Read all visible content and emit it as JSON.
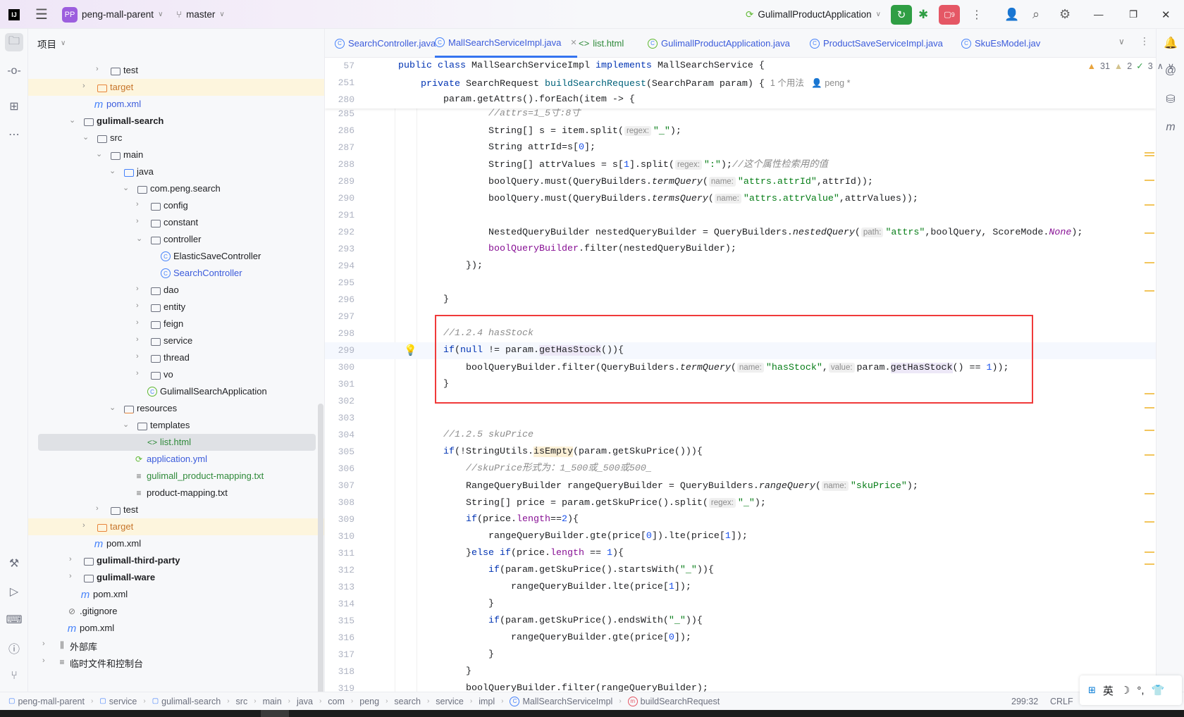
{
  "titlebar": {
    "logo": "IJ",
    "project_badge": "PP",
    "project_name": "peng-mall-parent",
    "branch": "master",
    "run_config": "GulimallProductApplication",
    "stop_count": "9",
    "icons": [
      "menu-icon",
      "branch-icon",
      "rerun-icon",
      "debug-icon",
      "stop-icon",
      "more-icon",
      "add-user-icon",
      "search-icon",
      "settings-icon",
      "minimize-icon",
      "restore-icon",
      "close-icon"
    ]
  },
  "project_panel": {
    "title": "项目",
    "rows": [
      {
        "n": 4,
        "chev": "right",
        "icon": "folder",
        "label": "test"
      },
      {
        "n": 3,
        "chev": "right",
        "icon": "folder-orange",
        "label": "target",
        "style": "orange",
        "hl": true
      },
      {
        "n": 3,
        "chev": "",
        "icon": "maven",
        "label": "pom.xml",
        "style": "blue"
      },
      {
        "n": 2,
        "chev": "down",
        "icon": "module",
        "label": "gulimall-search",
        "style": "bold"
      },
      {
        "n": 3,
        "chev": "down",
        "icon": "folder",
        "label": "src"
      },
      {
        "n": 4,
        "chev": "down",
        "icon": "folder",
        "label": "main"
      },
      {
        "n": 5,
        "chev": "down",
        "icon": "folder-blue",
        "label": "java"
      },
      {
        "n": 6,
        "chev": "down",
        "icon": "package",
        "label": "com.peng.search"
      },
      {
        "n": 7,
        "chev": "right",
        "icon": "package",
        "label": "config"
      },
      {
        "n": 7,
        "chev": "right",
        "icon": "package",
        "label": "constant"
      },
      {
        "n": 7,
        "chev": "down",
        "icon": "package",
        "label": "controller"
      },
      {
        "n": 8,
        "chev": "",
        "icon": "class",
        "label": "ElasticSaveController"
      },
      {
        "n": 8,
        "chev": "",
        "icon": "class",
        "label": "SearchController",
        "style": "blue"
      },
      {
        "n": 7,
        "chev": "right",
        "icon": "package",
        "label": "dao"
      },
      {
        "n": 7,
        "chev": "right",
        "icon": "package",
        "label": "entity"
      },
      {
        "n": 7,
        "chev": "right",
        "icon": "package",
        "label": "feign"
      },
      {
        "n": 7,
        "chev": "right",
        "icon": "package",
        "label": "service"
      },
      {
        "n": 7,
        "chev": "right",
        "icon": "package",
        "label": "thread"
      },
      {
        "n": 7,
        "chev": "right",
        "icon": "package",
        "label": "vo"
      },
      {
        "n": 7,
        "chev": "",
        "icon": "spring-class",
        "label": "GulimallSearchApplication"
      },
      {
        "n": 5,
        "chev": "down",
        "icon": "resources",
        "label": "resources"
      },
      {
        "n": 6,
        "chev": "down",
        "icon": "folder",
        "label": "templates"
      },
      {
        "n": 7,
        "chev": "",
        "icon": "html",
        "label": "list.html",
        "style": "green",
        "sel": true
      },
      {
        "n": 6,
        "chev": "",
        "icon": "spring-yml",
        "label": "application.yml",
        "style": "blue"
      },
      {
        "n": 6,
        "chev": "",
        "icon": "text",
        "label": "gulimall_product-mapping.txt",
        "style": "green"
      },
      {
        "n": 6,
        "chev": "",
        "icon": "text",
        "label": "product-mapping.txt"
      },
      {
        "n": 4,
        "chev": "right",
        "icon": "folder",
        "label": "test"
      },
      {
        "n": 3,
        "chev": "right",
        "icon": "folder-orange",
        "label": "target",
        "style": "orange",
        "hl": true
      },
      {
        "n": 3,
        "chev": "",
        "icon": "maven",
        "label": "pom.xml"
      },
      {
        "n": 2,
        "chev": "right",
        "icon": "module",
        "label": "gulimall-third-party",
        "style": "bold"
      },
      {
        "n": 2,
        "chev": "right",
        "icon": "module",
        "label": "gulimall-ware",
        "style": "bold"
      },
      {
        "n": 2,
        "chev": "",
        "icon": "maven",
        "label": "pom.xml"
      },
      {
        "n": 1,
        "chev": "",
        "icon": "ignore",
        "label": ".gitignore"
      },
      {
        "n": 1,
        "chev": "",
        "icon": "maven",
        "label": "pom.xml"
      },
      {
        "n": 0,
        "chev": "right",
        "icon": "library",
        "label": "外部库"
      },
      {
        "n": 0,
        "chev": "right",
        "icon": "scratch",
        "label": "临时文件和控制台"
      }
    ]
  },
  "tabs": [
    {
      "label": "SearchController.java",
      "icon": "class",
      "color": "#3b5bdb"
    },
    {
      "label": "MallSearchServiceImpl.java",
      "icon": "class",
      "color": "#3b5bdb",
      "active": true
    },
    {
      "label": "list.html",
      "icon": "html",
      "color": "#2f8a3a"
    },
    {
      "label": "GulimallProductApplication.java",
      "icon": "spring-class",
      "color": "#3b5bdb"
    },
    {
      "label": "ProductSaveServiceImpl.java",
      "icon": "class",
      "color": "#3b5bdb"
    },
    {
      "label": "SkuEsModel.jav",
      "icon": "class",
      "color": "#3b5bdb"
    }
  ],
  "inspections": {
    "warnings": "31",
    "weak_warnings": "2",
    "typos": "3"
  },
  "sticky_lines": [
    {
      "n": "57",
      "t": [
        [
          "kw",
          "public class "
        ],
        [
          "p",
          "MallSearchServiceImpl "
        ],
        [
          "kw",
          "implements "
        ],
        [
          "p",
          "MallSearchService {"
        ]
      ]
    },
    {
      "n": "251",
      "t": [
        [
          "kw",
          "    private "
        ],
        [
          "p",
          "SearchRequest "
        ],
        [
          "fd",
          "buildSearchRequest"
        ],
        [
          "p",
          "(SearchParam param) { "
        ],
        [
          "meta",
          "1 个用法"
        ],
        [
          "meta",
          "   👤 peng *"
        ]
      ]
    },
    {
      "n": "280",
      "t": [
        [
          "p",
          "        param.getAttrs().forEach(item -> {"
        ]
      ]
    }
  ],
  "code_lines": [
    {
      "n": "285",
      "t": [
        [
          "cm",
          "                //attrs=1_5寸:8寸"
        ]
      ]
    },
    {
      "n": "286",
      "t": [
        [
          "p",
          "                String[] s = item.split("
        ],
        [
          "hint",
          "regex:"
        ],
        [
          "str",
          "\"_\""
        ],
        [
          "p",
          ");"
        ]
      ]
    },
    {
      "n": "287",
      "t": [
        [
          "p",
          "                String attrId=s["
        ],
        [
          "num",
          "0"
        ],
        [
          "p",
          "];"
        ]
      ]
    },
    {
      "n": "288",
      "t": [
        [
          "p",
          "                String[] attrValues = s["
        ],
        [
          "num",
          "1"
        ],
        [
          "p",
          "].split("
        ],
        [
          "hint",
          "regex:"
        ],
        [
          "str",
          "\":\""
        ],
        [
          "p",
          ");"
        ],
        [
          "cm",
          "//这个属性检索用的值"
        ]
      ]
    },
    {
      "n": "289",
      "t": [
        [
          "p",
          "                boolQuery.must(QueryBuilders."
        ],
        [
          "it",
          "termQuery"
        ],
        [
          "p",
          "("
        ],
        [
          "hint",
          "name:"
        ],
        [
          "str",
          "\"attrs.attrId\""
        ],
        [
          "p",
          ",attrId));"
        ]
      ]
    },
    {
      "n": "290",
      "t": [
        [
          "p",
          "                boolQuery.must(QueryBuilders."
        ],
        [
          "it",
          "termsQuery"
        ],
        [
          "p",
          "("
        ],
        [
          "hint",
          "name:"
        ],
        [
          "str",
          "\"attrs.attrValue\""
        ],
        [
          "p",
          ",attrValues));"
        ]
      ]
    },
    {
      "n": "291",
      "t": []
    },
    {
      "n": "292",
      "t": [
        [
          "p",
          "                NestedQueryBuilder nestedQueryBuilder = QueryBuilders."
        ],
        [
          "it",
          "nestedQuery"
        ],
        [
          "p",
          "("
        ],
        [
          "hint",
          "path:"
        ],
        [
          "str",
          "\"attrs\""
        ],
        [
          "p",
          ",boolQuery, ScoreMode."
        ],
        [
          "itp",
          "None"
        ],
        [
          "p",
          ");"
        ]
      ]
    },
    {
      "n": "293",
      "t": [
        [
          "fld",
          "                boolQueryBuilder"
        ],
        [
          "p",
          ".filter(nestedQueryBuilder);"
        ]
      ]
    },
    {
      "n": "294",
      "t": [
        [
          "p",
          "            });"
        ]
      ]
    },
    {
      "n": "295",
      "t": []
    },
    {
      "n": "296",
      "t": [
        [
          "p",
          "        }"
        ]
      ]
    },
    {
      "n": "297",
      "t": []
    },
    {
      "n": "298",
      "t": [
        [
          "cm",
          "        //1.2.4 hasStock"
        ]
      ]
    },
    {
      "n": "299",
      "cur": true,
      "t": [
        [
          "kw",
          "        if"
        ],
        [
          "p",
          "("
        ],
        [
          "kw",
          "null"
        ],
        [
          "p",
          " != param."
        ],
        [
          "mh",
          "getHasStock"
        ],
        [
          "p",
          "()){"
        ]
      ]
    },
    {
      "n": "300",
      "t": [
        [
          "p",
          "            boolQueryBuilder.filter(QueryBuilders."
        ],
        [
          "it",
          "termQuery"
        ],
        [
          "p",
          "("
        ],
        [
          "hint",
          "name:"
        ],
        [
          "str",
          "\"hasStock\""
        ],
        [
          "p",
          ","
        ],
        [
          "hint",
          "value:"
        ],
        [
          "p",
          "param."
        ],
        [
          "mh",
          "getHasStock"
        ],
        [
          "p",
          "() == "
        ],
        [
          "num",
          "1"
        ],
        [
          "p",
          "));"
        ]
      ]
    },
    {
      "n": "301",
      "t": [
        [
          "p",
          "        }"
        ]
      ]
    },
    {
      "n": "302",
      "t": []
    },
    {
      "n": "303",
      "t": []
    },
    {
      "n": "304",
      "t": [
        [
          "cm",
          "        //1.2.5 skuPrice"
        ]
      ]
    },
    {
      "n": "305",
      "t": [
        [
          "kw",
          "        if"
        ],
        [
          "p",
          "(!StringUtils."
        ],
        [
          "yh",
          "isEmpty"
        ],
        [
          "p",
          "(param.getSkuPrice())){"
        ]
      ]
    },
    {
      "n": "306",
      "t": [
        [
          "cm",
          "            //skuPrice形式为：1_500或_500或500_"
        ]
      ]
    },
    {
      "n": "307",
      "t": [
        [
          "p",
          "            RangeQueryBuilder rangeQueryBuilder = QueryBuilders."
        ],
        [
          "it",
          "rangeQuery"
        ],
        [
          "p",
          "("
        ],
        [
          "hint",
          "name:"
        ],
        [
          "str",
          "\"skuPrice\""
        ],
        [
          "p",
          ");"
        ]
      ]
    },
    {
      "n": "308",
      "t": [
        [
          "p",
          "            String[] price = param.getSkuPrice().split("
        ],
        [
          "hint",
          "regex:"
        ],
        [
          "str",
          "\"_\""
        ],
        [
          "p",
          ");"
        ]
      ]
    },
    {
      "n": "309",
      "t": [
        [
          "kw",
          "            if"
        ],
        [
          "p",
          "(price."
        ],
        [
          "fld",
          "length"
        ],
        [
          "p",
          "=="
        ],
        [
          "num",
          "2"
        ],
        [
          "p",
          "){"
        ]
      ]
    },
    {
      "n": "310",
      "t": [
        [
          "p",
          "                rangeQueryBuilder.gte(price["
        ],
        [
          "num",
          "0"
        ],
        [
          "p",
          "]).lte(price["
        ],
        [
          "num",
          "1"
        ],
        [
          "p",
          "]);"
        ]
      ]
    },
    {
      "n": "311",
      "t": [
        [
          "p",
          "            }"
        ],
        [
          "kw",
          "else if"
        ],
        [
          "p",
          "(price."
        ],
        [
          "fld",
          "length"
        ],
        [
          "p",
          " == "
        ],
        [
          "num",
          "1"
        ],
        [
          "p",
          "){"
        ]
      ]
    },
    {
      "n": "312",
      "t": [
        [
          "kw",
          "                if"
        ],
        [
          "p",
          "(param.getSkuPrice().startsWith("
        ],
        [
          "str",
          "\"_\""
        ],
        [
          "p",
          ")){"
        ]
      ]
    },
    {
      "n": "313",
      "t": [
        [
          "p",
          "                    rangeQueryBuilder.lte(price["
        ],
        [
          "num",
          "1"
        ],
        [
          "p",
          "]);"
        ]
      ]
    },
    {
      "n": "314",
      "t": [
        [
          "p",
          "                }"
        ]
      ]
    },
    {
      "n": "315",
      "t": [
        [
          "kw",
          "                if"
        ],
        [
          "p",
          "(param.getSkuPrice().endsWith("
        ],
        [
          "str",
          "\"_\""
        ],
        [
          "p",
          ")){"
        ]
      ]
    },
    {
      "n": "316",
      "t": [
        [
          "p",
          "                    rangeQueryBuilder.gte(price["
        ],
        [
          "num",
          "0"
        ],
        [
          "p",
          "]);"
        ]
      ]
    },
    {
      "n": "317",
      "t": [
        [
          "p",
          "                }"
        ]
      ]
    },
    {
      "n": "318",
      "t": [
        [
          "p",
          "            }"
        ]
      ]
    },
    {
      "n": "319",
      "t": [
        [
          "p",
          "            boolQueryBuilder.filter(rangeQueryBuilder);"
        ]
      ]
    }
  ],
  "breadcrumb": [
    "peng-mall-parent",
    "service",
    "gulimall-search",
    "src",
    "main",
    "java",
    "com",
    "peng",
    "search",
    "service",
    "impl",
    "MallSearchServiceImpl",
    "buildSearchRequest"
  ],
  "status": {
    "position": "299:32",
    "line_ending": "CRLF"
  },
  "ime": {
    "lang": "英"
  },
  "colors": {
    "accent": "#3574f0",
    "highlight_box": "#f03a3a",
    "run_green": "#2f9e44",
    "stop_red": "#e55765"
  }
}
